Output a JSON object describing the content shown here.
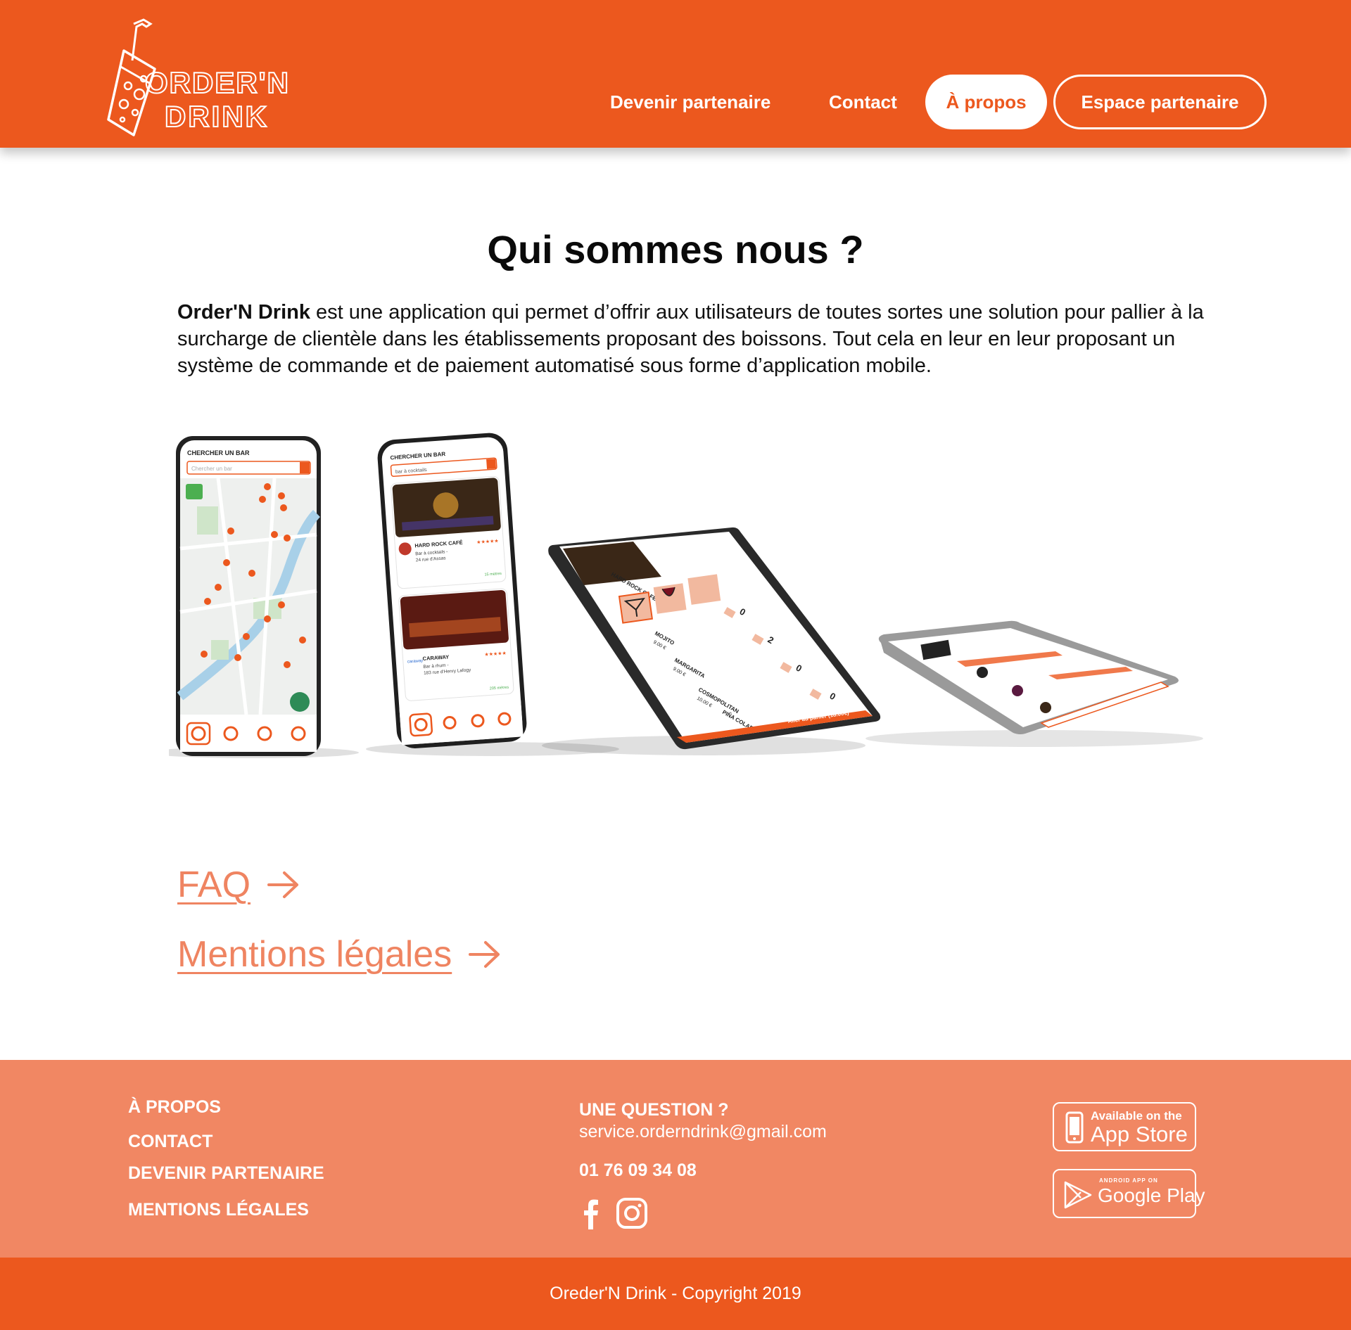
{
  "brand": {
    "logo_line1": "ORDER'N",
    "logo_line2": "DRINK"
  },
  "nav": {
    "partner": "Devenir partenaire",
    "contact": "Contact",
    "about": "À propos",
    "space": "Espace partenaire"
  },
  "main": {
    "title": "Qui sommes nous ?",
    "intro_brand": "Order'N Drink",
    "intro_text": " est une application qui permet d’offrir aux utilisateurs de toutes sortes une solution pour pallier à la surcharge de clientèle dans les établissements proposant des boissons. Tout cela en leur en leur proposant un système de commande et de paiement automatisé sous forme d’application mobile.",
    "faq": "FAQ",
    "mentions": "Mentions légales"
  },
  "mockups": {
    "phone1": {
      "header": "CHERCHER UN BAR",
      "search_placeholder": "Chercher un bar"
    },
    "phone2": {
      "header": "CHERCHER UN BAR",
      "search_value": "bar à cocktails",
      "card1_name": "HARD ROCK CAFÉ",
      "card1_sub1": "Bar à cocktails -",
      "card1_sub2": "24 rue d'Assas",
      "card1_dist": "15 mètres",
      "card2_name": "CARAWAY",
      "card2_sub1": "Bar à rhum -",
      "card2_sub2": "183 rue d'Henry Lafogy",
      "card2_dist": "205 mètres"
    },
    "phone3": {
      "bar": "HARD ROCK CAFÉ",
      "items": [
        {
          "name": "MOJITO",
          "price": "9.00 €",
          "qty": "0"
        },
        {
          "name": "MARGARITA",
          "price": "9.00 €",
          "qty": "2"
        },
        {
          "name": "COSMOPOLITAN",
          "price": "10.00 €",
          "qty": "0"
        },
        {
          "name": "PIÑA COLADA",
          "price": "",
          "qty": "0"
        }
      ],
      "cta": "Aller au panier (18.00€)"
    }
  },
  "footer": {
    "about": "À PROPOS",
    "contact": "CONTACT",
    "partner": "DEVENIR PARTENAIRE",
    "mentions": "MENTIONS LÉGALES",
    "question": "UNE QUESTION ?",
    "email": "service.orderndrink@gmail.com",
    "phone": "01 76 09 34 08",
    "appstore_small": "Available on the",
    "appstore_large": "App Store",
    "gplay_small": "ANDROID APP ON",
    "gplay_large": "Google Play",
    "copyright": "Oreder'N Drink - Copyright 2019"
  },
  "colors": {
    "primary": "#ec581e",
    "footer_bg": "#f18763",
    "link": "#ef8461"
  }
}
